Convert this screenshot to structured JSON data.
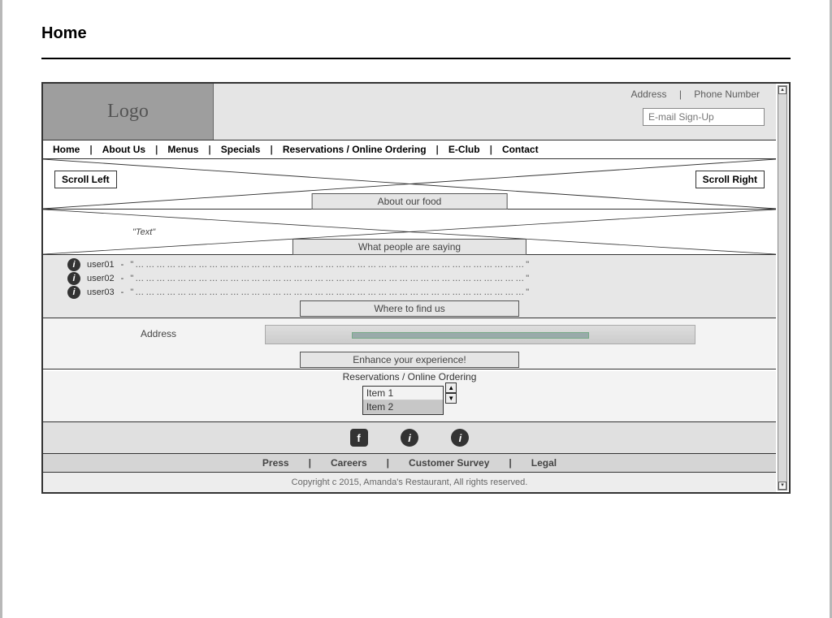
{
  "page_title": "Home",
  "logo_text": "Logo",
  "header": {
    "address_label": "Address",
    "phone_label": "Phone Number",
    "email_placeholder": "E-mail Sign-Up"
  },
  "nav": [
    "Home",
    "About Us",
    "Menus",
    "Specials",
    "Reservations / Online Ordering",
    "E-Club",
    "Contact"
  ],
  "carousel": {
    "scroll_left": "Scroll Left",
    "scroll_right": "Scroll Right",
    "section_label": "About our food"
  },
  "about_text_placeholder": "\"Text\"",
  "testimonials": {
    "section_label": "What people are saying",
    "rows": [
      {
        "user": "user01",
        "text": "\"…………………………………………………………………………………………………\""
      },
      {
        "user": "user02",
        "text": "\"…………………………………………………………………………………………………\""
      },
      {
        "user": "user03",
        "text": "\"…………………………………………………………………………………………………\""
      }
    ]
  },
  "where": {
    "section_label": "Where to find us",
    "address_label": "Address"
  },
  "enhance": {
    "section_label": "Enhance your experience!",
    "sub_label": "Reservations / Online Ordering",
    "items": [
      "Item 1",
      "Item 2"
    ]
  },
  "footer_nav": [
    "Press",
    "Careers",
    "Customer Survey",
    "Legal"
  ],
  "copyright": "Copyright c 2015, Amanda's Restaurant, All rights reserved."
}
